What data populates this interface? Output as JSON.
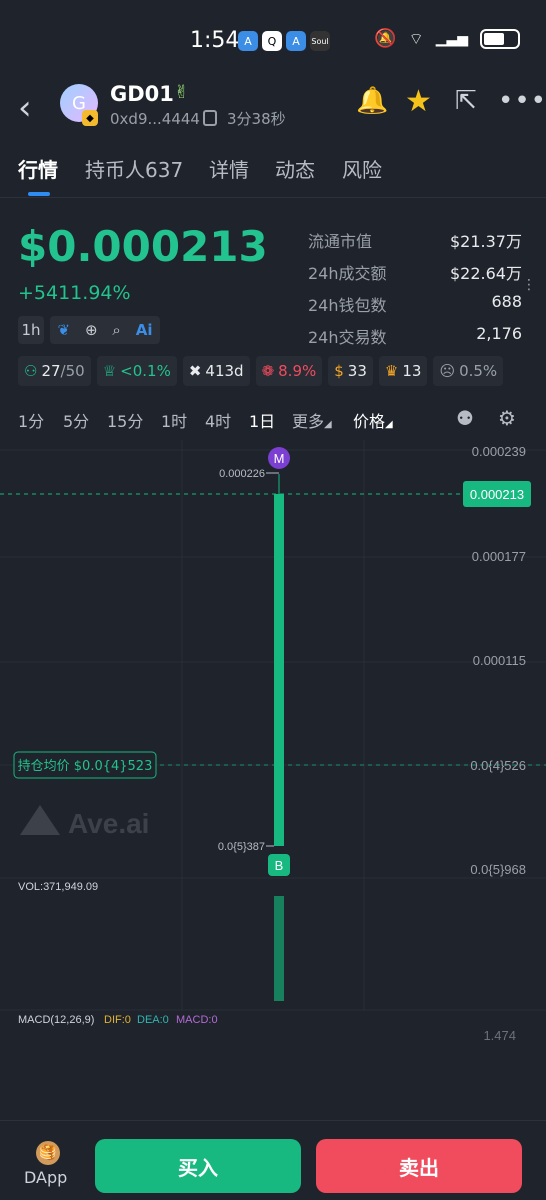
{
  "status": {
    "time": "1:54",
    "apps": [
      "A",
      "Q",
      "A",
      "Soul"
    ],
    "network": "5G",
    "battery": ""
  },
  "header": {
    "avatar_letter": "G",
    "token_name": "GD01",
    "address": "0xd9...4444",
    "age": "3分38秒"
  },
  "tabs": [
    "行情",
    "持币人637",
    "详情",
    "动态",
    "风险"
  ],
  "price": {
    "value": "$0.000213",
    "change": "+5411.94%"
  },
  "stats": [
    {
      "label": "流通市值",
      "value": "$21.37万"
    },
    {
      "label": "24h成交额",
      "value": "$22.64万"
    },
    {
      "label": "24h钱包数",
      "value": "688"
    },
    {
      "label": "24h交易数",
      "value": "2,176"
    }
  ],
  "tools": {
    "interval": "1h",
    "ai_label": "Ai"
  },
  "badges": [
    {
      "icon": "holder-icon",
      "value": "27",
      "suffix": "/50",
      "color": "#22c38e"
    },
    {
      "icon": "chef-icon",
      "value": "<0.1%",
      "suffix": "",
      "color": "#22c38e"
    },
    {
      "icon": "x-icon",
      "value": "413d",
      "suffix": "",
      "color": "#e8eaed"
    },
    {
      "icon": "bundle-icon",
      "value": "8.9%",
      "suffix": "",
      "color": "#f04c5d"
    },
    {
      "icon": "money-bag-icon",
      "value": "33",
      "suffix": "",
      "color": "#e8eaed"
    },
    {
      "icon": "trophy-icon",
      "value": "13",
      "suffix": "",
      "color": "#e8eaed"
    },
    {
      "icon": "ghost-icon",
      "value": "0.5%",
      "suffix": "",
      "color": "#9aa0a8"
    }
  ],
  "timeframes": [
    "1分",
    "5分",
    "15分",
    "1时",
    "4时",
    "1日",
    "更多",
    "价格"
  ],
  "active_timeframe": "1日",
  "chart_data": {
    "type": "candlestick",
    "y_tick_labels": [
      "0.000239",
      "0.000177",
      "0.000115",
      "0.0{4}526",
      "0.0{5}968"
    ],
    "current_price_label": "0.000213",
    "high_label": "0.000226",
    "low_label": "0.0{5}387",
    "avg_cost_label": "持仓均价 $0.0{4}523",
    "marker_top": "M",
    "marker_bottom": "B",
    "watermark": "Ave.ai",
    "candle": {
      "open": 3.9e-06,
      "close": 0.000213,
      "high": 0.000226,
      "low": 3.9e-06
    },
    "volume_label": "VOL:371,949.09",
    "macd": {
      "label": "MACD(12,26,9)",
      "dif": "DIF:0",
      "dea": "DEA:0",
      "macd": "MACD:0",
      "scale": "1.474"
    },
    "colors": {
      "up": "#17b981",
      "grid": "#2a2f37",
      "dif": "#e0b332",
      "dea": "#2fb6b0",
      "macd": "#b36bd6"
    }
  },
  "bottom": {
    "dapp": "DApp",
    "buy": "买入",
    "sell": "卖出"
  }
}
